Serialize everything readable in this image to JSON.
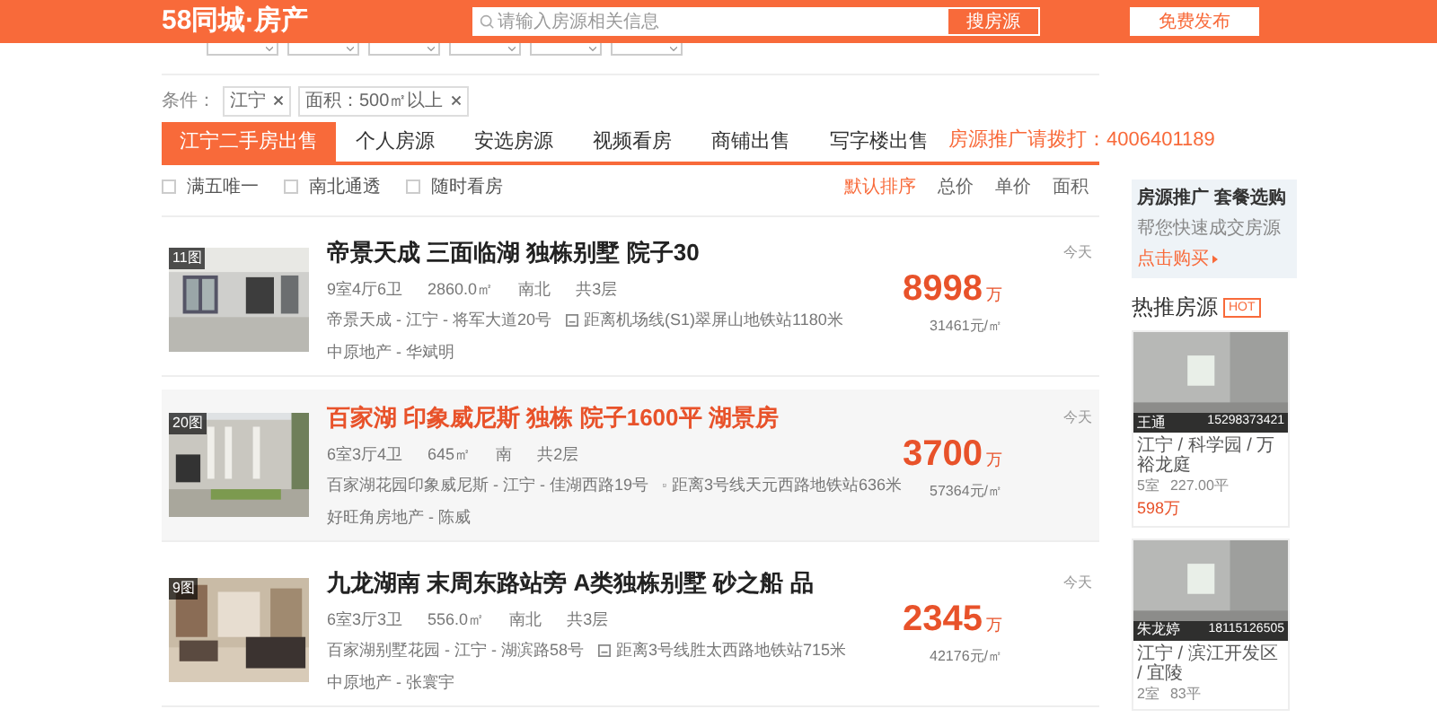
{
  "header": {
    "logo": "58同城·房产",
    "search_placeholder": "请输入房源相关信息",
    "search_button": "搜房源",
    "post_button": "免费发布"
  },
  "conditions": {
    "label": "条件：",
    "tags": [
      {
        "label": "江宁"
      },
      {
        "label": "面积：500㎡以上"
      }
    ]
  },
  "tabs": [
    {
      "label": "江宁二手房出售",
      "selected": true
    },
    {
      "label": "个人房源",
      "selected": false
    },
    {
      "label": "安选房源",
      "selected": false
    },
    {
      "label": "视频看房",
      "selected": false
    },
    {
      "label": "商铺出售",
      "selected": false
    },
    {
      "label": "写字楼出售",
      "selected": false
    }
  ],
  "hotline": "房源推广请拨打：4006401189",
  "filters": [
    {
      "label": "满五唯一",
      "checked": false
    },
    {
      "label": "南北通透",
      "checked": false
    },
    {
      "label": "随时看房",
      "checked": false
    }
  ],
  "sorts": [
    {
      "label": "默认排序",
      "selected": true
    },
    {
      "label": "总价",
      "selected": false
    },
    {
      "label": "单价",
      "selected": false
    },
    {
      "label": "面积",
      "selected": false
    }
  ],
  "listings": [
    {
      "photo_count": "11图",
      "title": "帝景天成 三面临湖 独栋别墅 院子30",
      "highlighted": false,
      "specs": [
        "9室4厅6卫",
        "2860.0㎡",
        "南北",
        "共3层"
      ],
      "address": "帝景天成 - 江宁 - 将军大道20号",
      "subway": "距离机场线(S1)翠屏山地铁站1180米",
      "agent": "中原地产 - 华斌明",
      "price": "8998",
      "price_unit": "万",
      "unit_price": "31461元/㎡",
      "date": "今天"
    },
    {
      "photo_count": "20图",
      "title": "百家湖 印象威尼斯 独栋 院子1600平 湖景房",
      "highlighted": true,
      "specs": [
        "6室3厅4卫",
        "645㎡",
        "南",
        "共2层"
      ],
      "address": "百家湖花园印象威尼斯 - 江宁 - 佳湖西路19号",
      "subway": "距离3号线天元西路地铁站636米",
      "agent": "好旺角房地产 - 陈威",
      "price": "3700",
      "price_unit": "万",
      "unit_price": "57364元/㎡",
      "date": "今天"
    },
    {
      "photo_count": "9图",
      "title": "九龙湖南 末周东路站旁 A类独栋别墅 砂之船 品",
      "highlighted": false,
      "specs": [
        "6室3厅3卫",
        "556.0㎡",
        "南北",
        "共3层"
      ],
      "address": "百家湖别墅花园 - 江宁 - 湖滨路58号",
      "subway": "距离3号线胜太西路地铁站715米",
      "agent": "中原地产 - 张寰宇",
      "price": "2345",
      "price_unit": "万",
      "unit_price": "42176元/㎡",
      "date": "今天"
    }
  ],
  "ad": {
    "title": "房源推广 套餐选购",
    "subtitle": "帮您快速成交房源",
    "link": "点击购买"
  },
  "hot": {
    "title": "热推房源",
    "badge": "HOT",
    "cards": [
      {
        "name": "王通",
        "phone": "15298373421",
        "location": "江宁 / 科学园 / 万裕龙庭",
        "rooms": "5室",
        "area": "227.00平",
        "price": "598万"
      },
      {
        "name": "朱龙婷",
        "phone": "18115126505",
        "location": "江宁 / 滨江开发区 / 宜陵",
        "rooms": "2室",
        "area": "83平"
      }
    ]
  }
}
